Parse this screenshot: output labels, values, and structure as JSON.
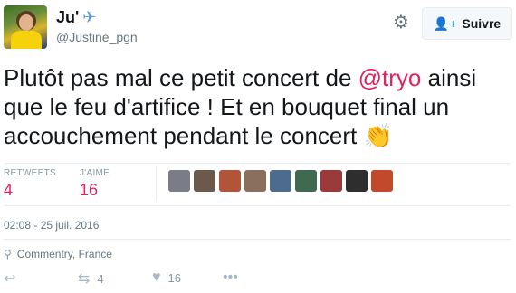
{
  "header": {
    "display_name": "Ju'",
    "handle": "@Justine_pgn",
    "follow_label": "Suivre"
  },
  "tweet": {
    "text_before": "Plutôt pas mal ce petit concert de ",
    "mention": "@tryo",
    "text_after": " ainsi que le feu d'artifice ! Et en bouquet final un accouchement pendant le concert "
  },
  "stats": {
    "retweets_label": "RETWEETS",
    "retweets_value": "4",
    "likes_label": "J'AIME",
    "likes_value": "16"
  },
  "likers": [
    {
      "name": "liker-1",
      "color": "#7a7d86"
    },
    {
      "name": "liker-2",
      "color": "#6b5a4b"
    },
    {
      "name": "liker-3",
      "color": "#b0543a"
    },
    {
      "name": "liker-4",
      "color": "#8a6f5c"
    },
    {
      "name": "liker-5",
      "color": "#4d6b8c"
    },
    {
      "name": "liker-6",
      "color": "#3f6a50"
    },
    {
      "name": "liker-7",
      "color": "#9b3a3a"
    },
    {
      "name": "liker-8",
      "color": "#2e2e2e"
    },
    {
      "name": "liker-9",
      "color": "#c24a2c"
    }
  ],
  "meta": {
    "time": "02:08 - 25 juil. 2016",
    "location": "Commentry, France"
  },
  "actions": {
    "retweet_count": "4",
    "like_count": "16"
  },
  "colors": {
    "accent": "#e0245e",
    "link_blue": "#1da1f2",
    "muted": "#657786"
  },
  "icons": {
    "badge": "airplane-icon",
    "settings": "gear-icon",
    "follow": "add-user-icon",
    "emoji": "clapping-hands-icon",
    "location": "pin-icon",
    "reply": "reply-icon",
    "retweet": "retweet-icon",
    "like": "heart-icon",
    "more": "more-icon"
  }
}
